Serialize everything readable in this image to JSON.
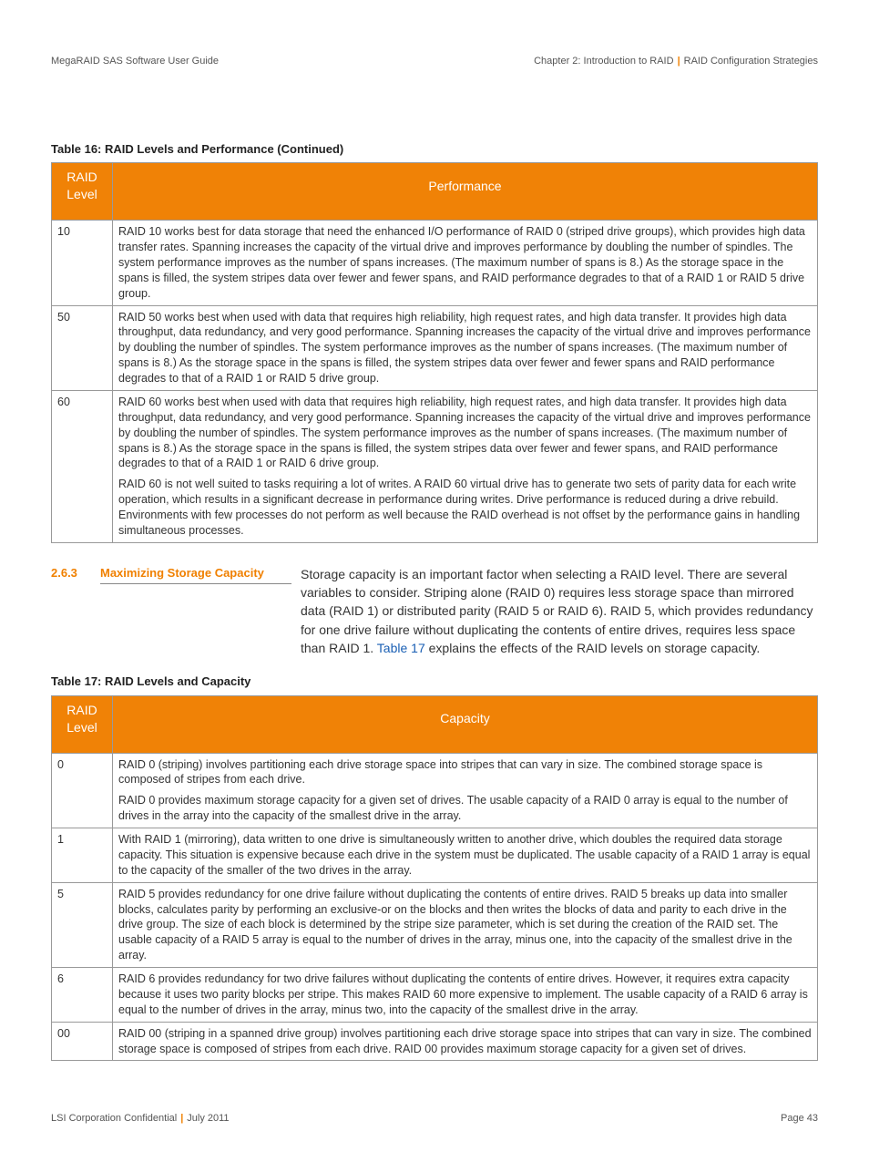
{
  "header": {
    "left": "MegaRAID SAS Software User Guide",
    "right_chapter": "Chapter 2: Introduction to RAID",
    "right_topic": "RAID Configuration Strategies"
  },
  "table16": {
    "caption": "Table 16:   RAID Levels and Performance (Continued)",
    "col1": "RAID Level",
    "col2": "Performance",
    "rows": [
      {
        "level": "10",
        "paras": [
          "RAID 10 works best for data storage that need the enhanced I/O performance of RAID 0 (striped drive groups), which provides high data transfer rates. Spanning increases the capacity of the virtual drive and improves performance by doubling the number of spindles. The system performance improves as the number of spans increases. (The maximum number of spans is 8.) As the storage space in the spans is filled, the system stripes data over fewer and fewer spans, and RAID performance degrades to that of a RAID 1 or RAID 5 drive group."
        ]
      },
      {
        "level": "50",
        "paras": [
          "RAID 50 works best when used with data that requires high reliability, high request rates, and high data transfer. It provides high data throughput, data redundancy, and very good performance. Spanning increases the capacity of the virtual drive and improves performance by doubling the number of spindles. The system performance improves as the number of spans increases. (The maximum number of spans is 8.) As the storage space in the spans is filled, the system stripes data over fewer and fewer spans and RAID performance degrades to that of a RAID 1 or RAID 5 drive group."
        ]
      },
      {
        "level": "60",
        "paras": [
          "RAID 60 works best when used with data that requires high reliability, high request rates, and high data transfer. It provides high data throughput, data redundancy, and very good performance. Spanning increases the capacity of the virtual drive and improves performance by doubling the number of spindles. The system performance improves as the number of spans increases. (The maximum number of spans is 8.) As the storage space in the spans is filled, the system stripes data over fewer and fewer spans, and RAID performance degrades to that of a RAID 1 or RAID 6 drive group.",
          "RAID 60 is not well suited to tasks requiring a lot of writes. A RAID 60 virtual drive has to generate two sets of parity data for each write operation, which results in a significant decrease in performance during writes. Drive performance is reduced during a drive rebuild. Environments with few processes do not perform as well because the RAID overhead is not offset by the performance gains in handling simultaneous processes."
        ]
      }
    ]
  },
  "section": {
    "number": "2.6.3",
    "title": "Maximizing Storage Capacity",
    "text_before_link": "Storage capacity is an important factor when selecting a RAID level. There are several variables to consider. Striping alone (RAID 0) requires less storage space than mirrored data (RAID 1) or distributed parity (RAID 5 or RAID 6). RAID 5, which provides redundancy for one drive failure without duplicating the contents of entire drives, requires less space than RAID 1. ",
    "link": "Table 17",
    "text_after_link": " explains the effects of the RAID levels on storage capacity."
  },
  "table17": {
    "caption": "Table 17:   RAID Levels and Capacity",
    "col1": "RAID Level",
    "col2": "Capacity",
    "rows": [
      {
        "level": "0",
        "paras": [
          "RAID 0 (striping) involves partitioning each drive storage space into stripes that can vary in size. The combined storage space is composed of stripes from each drive.",
          "RAID 0 provides maximum storage capacity for a given set of drives. The usable capacity of a RAID 0 array is equal to the number of drives in the array into the capacity of the smallest drive in the array."
        ]
      },
      {
        "level": "1",
        "paras": [
          "With RAID 1 (mirroring), data written to one drive is simultaneously written to another drive, which doubles the required data storage capacity. This situation is expensive because each drive in the system must be duplicated. The usable capacity of a RAID 1 array is equal to the capacity of the smaller of the two drives in the array."
        ]
      },
      {
        "level": "5",
        "paras": [
          "RAID 5 provides redundancy for one drive failure without duplicating the contents of entire drives. RAID 5 breaks up data into smaller blocks, calculates parity by performing an exclusive-or on the blocks and then writes the blocks of data and parity to each drive in the drive group. The size of each block is determined by the stripe size parameter, which is set during the creation of the RAID set. The usable capacity of a RAID 5 array is equal to the number of drives in the array, minus one, into the capacity of the smallest drive in the array."
        ]
      },
      {
        "level": "6",
        "paras": [
          "RAID 6 provides redundancy for two drive failures without duplicating the contents of entire drives. However, it requires extra capacity because it uses two parity blocks per stripe. This makes RAID 60 more expensive to implement. The usable capacity of a RAID 6 array is equal to the number of drives in the array, minus two, into the capacity of the smallest drive in the array."
        ]
      },
      {
        "level": "00",
        "paras": [
          "RAID 00 (striping in a spanned drive group) involves partitioning each drive storage space into stripes that can vary in size. The combined storage space is composed of stripes from each drive. RAID 00 provides maximum storage capacity for a given set of drives."
        ]
      }
    ]
  },
  "footer": {
    "left_company": "LSI Corporation Confidential",
    "left_date": "July 2011",
    "right": "Page 43"
  }
}
